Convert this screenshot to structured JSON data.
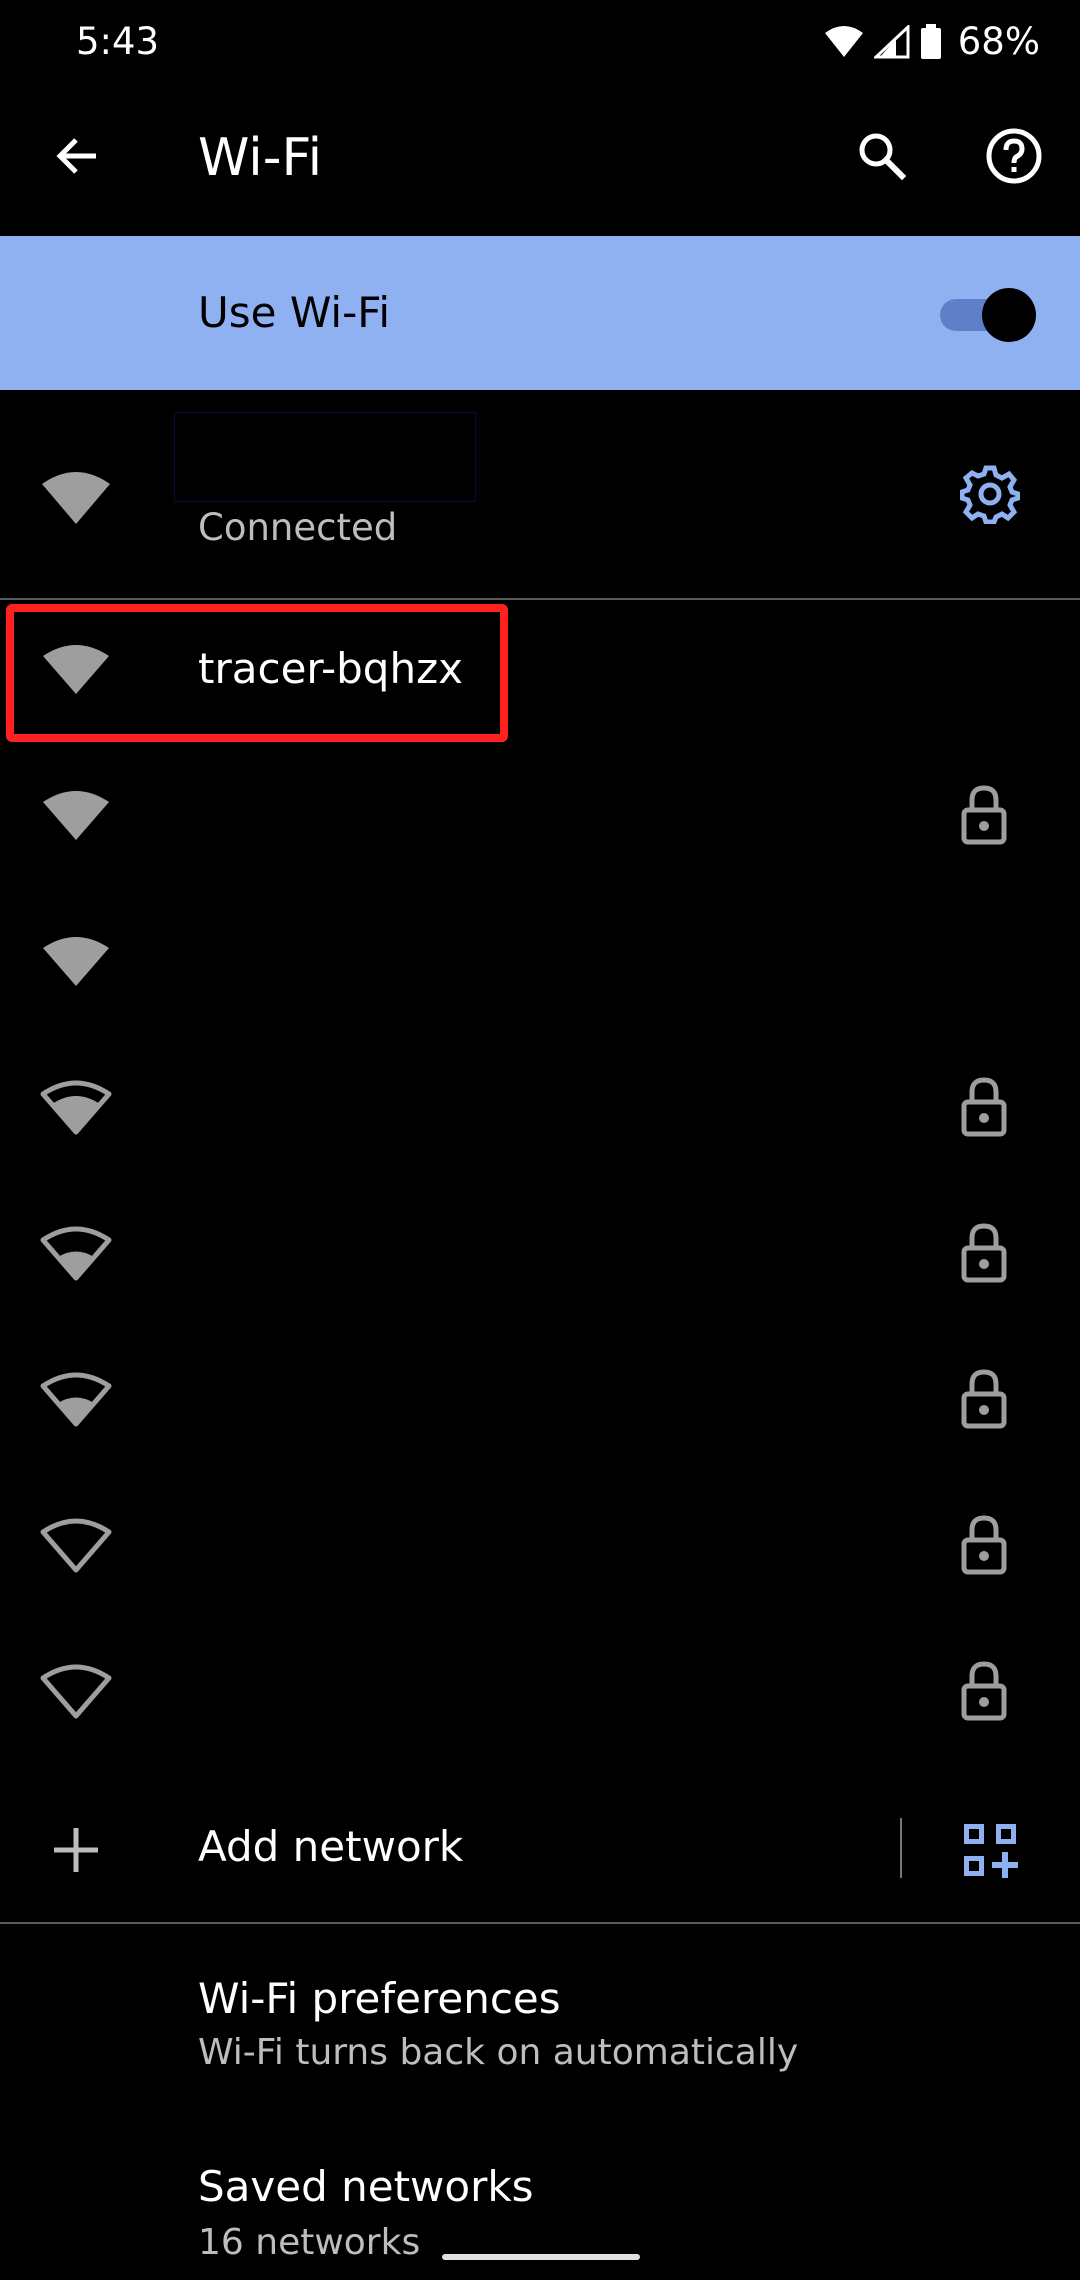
{
  "status_bar": {
    "time": "5:43",
    "battery": "68%"
  },
  "app_bar": {
    "title": "Wi-Fi"
  },
  "use_wifi": {
    "label": "Use Wi-Fi",
    "enabled": true
  },
  "connected": {
    "status": "Connected"
  },
  "networks": [
    {
      "name": "tracer-bqhzx",
      "locked": false,
      "signal": 4
    },
    {
      "name": "",
      "locked": true,
      "signal": 4
    },
    {
      "name": "",
      "locked": false,
      "signal": 4
    },
    {
      "name": "",
      "locked": true,
      "signal": 3
    },
    {
      "name": "",
      "locked": true,
      "signal": 2
    },
    {
      "name": "",
      "locked": true,
      "signal": 2
    },
    {
      "name": "",
      "locked": true,
      "signal": 1
    },
    {
      "name": "",
      "locked": true,
      "signal": 1
    }
  ],
  "add_network": {
    "label": "Add network"
  },
  "preferences": {
    "wifi_prefs": {
      "title": "Wi-Fi preferences",
      "subtitle": "Wi-Fi turns back on automatically"
    },
    "saved": {
      "title": "Saved networks",
      "subtitle": "16 networks"
    }
  },
  "colors": {
    "accent": "#8fb1f2",
    "icon_grey": "#9e9e9e",
    "highlight": "#ff2020"
  }
}
